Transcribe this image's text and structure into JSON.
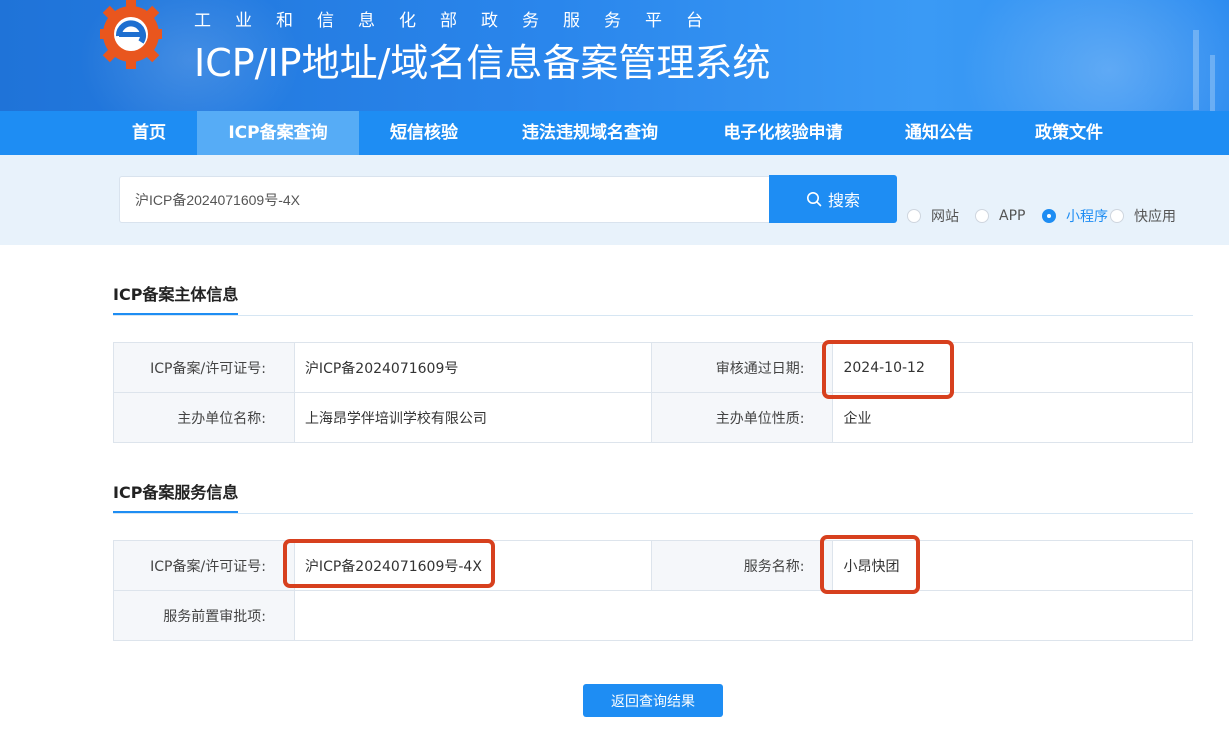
{
  "header": {
    "subtitle": "工业和信息化部政务服务平台",
    "title": "ICP/IP地址/域名信息备案管理系统",
    "logo_icon": "ministry-gear-logo-icon"
  },
  "nav": {
    "items": [
      {
        "label": "首页"
      },
      {
        "label": "ICP备案查询",
        "active": true
      },
      {
        "label": "短信核验"
      },
      {
        "label": "违法违规域名查询"
      },
      {
        "label": "电子化核验申请"
      },
      {
        "label": "通知公告"
      },
      {
        "label": "政策文件"
      }
    ]
  },
  "search": {
    "value": "沪ICP备2024071609号-4X",
    "button_label": "搜索",
    "button_icon": "search-icon",
    "options": [
      {
        "label": "网站",
        "checked": false
      },
      {
        "label": "APP",
        "checked": false
      },
      {
        "label": "小程序",
        "checked": true
      },
      {
        "label": "快应用",
        "checked": false
      }
    ]
  },
  "subject": {
    "title": "ICP备案主体信息",
    "license_label": "ICP备案/许可证号:",
    "license_value": "沪ICP备2024071609号",
    "approve_date_label": "审核通过日期:",
    "approve_date_value": "2024-10-12",
    "org_name_label": "主办单位名称:",
    "org_name_value": "上海昂学伴培训学校有限公司",
    "org_type_label": "主办单位性质:",
    "org_type_value": "企业"
  },
  "service": {
    "title": "ICP备案服务信息",
    "license_label": "ICP备案/许可证号:",
    "license_value": "沪ICP备2024071609号-4X",
    "name_label": "服务名称:",
    "name_value": "小昂快团",
    "preapproval_label": "服务前置审批项:",
    "preapproval_value": ""
  },
  "back_button_label": "返回查询结果",
  "colors": {
    "primary": "#1e8df3",
    "highlight": "#d7401e"
  }
}
